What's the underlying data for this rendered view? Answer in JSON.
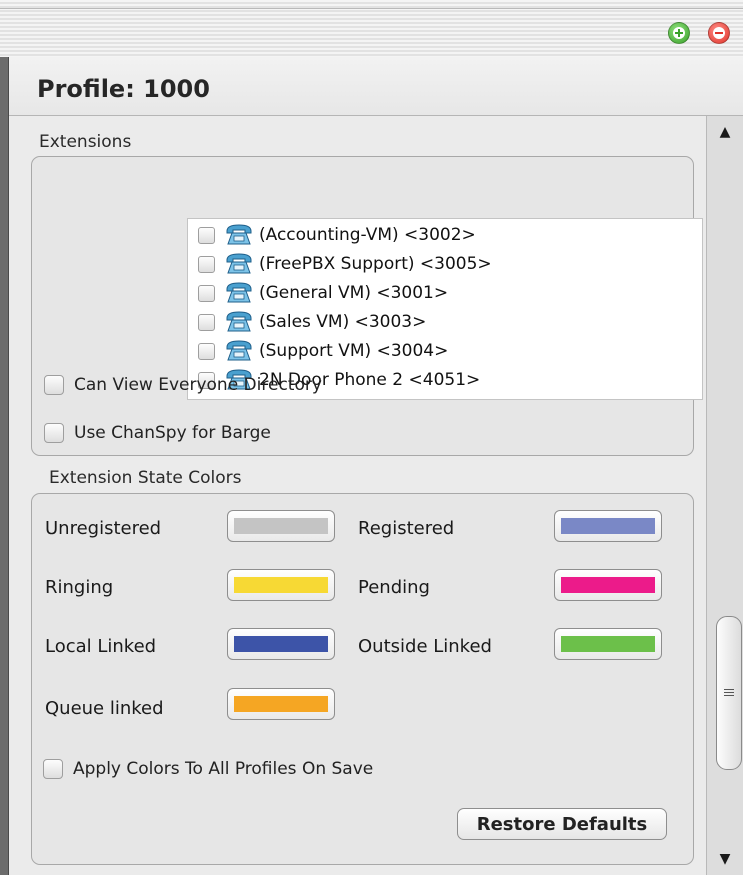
{
  "window": {
    "add_icon": "plus-circle-icon",
    "close_icon": "minus-circle-icon"
  },
  "profile": {
    "title": "Profile: 1000"
  },
  "extensions": {
    "section_label": "Extensions",
    "items": [
      {
        "label": "(Accounting-VM) <3002>",
        "checked": false,
        "icon": "phone-icon"
      },
      {
        "label": "(FreePBX Support) <3005>",
        "checked": false,
        "icon": "phone-icon"
      },
      {
        "label": "(General VM) <3001>",
        "checked": false,
        "icon": "phone-icon"
      },
      {
        "label": "(Sales VM) <3003>",
        "checked": false,
        "icon": "phone-icon"
      },
      {
        "label": "(Support VM) <3004>",
        "checked": false,
        "icon": "phone-icon"
      },
      {
        "label": "2N Door Phone 2 <4051>",
        "checked": false,
        "icon": "phone-icon"
      }
    ],
    "can_view_everyone": {
      "label": "Can View Everyone Directory",
      "checked": false
    },
    "use_chanspy": {
      "label": "Use ChanSpy for Barge",
      "checked": false
    }
  },
  "state_colors": {
    "section_label": "Extension State Colors",
    "unregistered": {
      "label": "Unregistered",
      "color": "#c4c4c4"
    },
    "registered": {
      "label": "Registered",
      "color": "#7a88c6"
    },
    "ringing": {
      "label": "Ringing",
      "color": "#f7d934"
    },
    "pending": {
      "label": "Pending",
      "color": "#ec1b8a"
    },
    "local_linked": {
      "label": "Local Linked",
      "color": "#3d54a8"
    },
    "outside_linked": {
      "label": "Outside Linked",
      "color": "#6cc04a"
    },
    "queue_linked": {
      "label": "Queue linked",
      "color": "#f5a623"
    },
    "apply_all": {
      "label": "Apply Colors To All Profiles On Save",
      "checked": false
    },
    "restore_label": "Restore Defaults"
  },
  "scrollbar": {
    "up_icon": "▲",
    "down_icon": "▼",
    "thumb_icon": "grip-icon"
  }
}
